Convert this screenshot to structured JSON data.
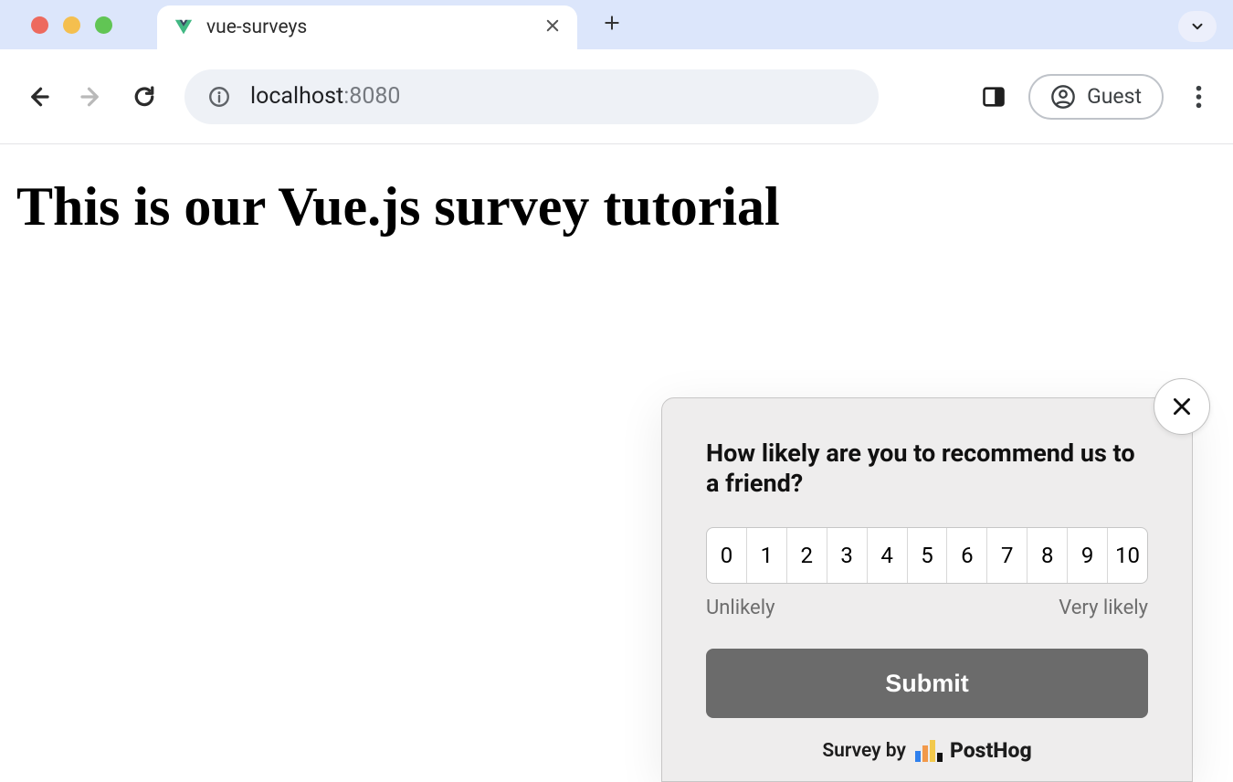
{
  "browser": {
    "tab_title": "vue-surveys",
    "url_host": "localhost",
    "url_port": ":8080",
    "profile_label": "Guest"
  },
  "page": {
    "heading": "This is our Vue.js survey tutorial"
  },
  "survey": {
    "question": "How likely are you to recommend us to a friend?",
    "options": [
      "0",
      "1",
      "2",
      "3",
      "4",
      "5",
      "6",
      "7",
      "8",
      "9",
      "10"
    ],
    "low_label": "Unlikely",
    "high_label": "Very likely",
    "submit_label": "Submit",
    "footer_prefix": "Survey by",
    "brand": "PostHog"
  }
}
